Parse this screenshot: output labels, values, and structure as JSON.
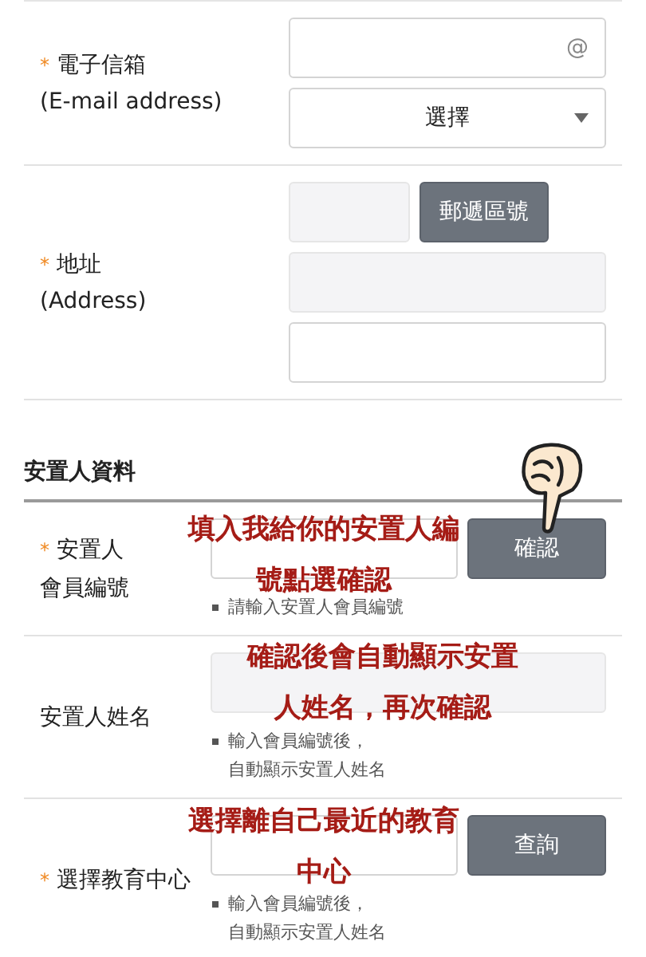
{
  "contact_rows": [
    {
      "kind": "email",
      "required_mark": "*",
      "label": "電子信箱",
      "sublabel": "(E-mail address)",
      "at_sign": "@",
      "select_value": "選擇"
    },
    {
      "kind": "address",
      "required_mark": "*",
      "label": "地址",
      "sublabel": "(Address)",
      "zip_button": "郵遞區號"
    }
  ],
  "section_title": "安置人資料",
  "sponsor_rows": [
    {
      "kind": "input_button",
      "required_mark": "*",
      "label": "安置人",
      "sublabel": "會員編號",
      "button": "確認",
      "help": [
        "請輸入安置人會員編號"
      ],
      "note": [
        "填入我給你的安置人編",
        "號點選確認"
      ]
    },
    {
      "kind": "readonly",
      "label": "安置人姓名",
      "help": [
        "輸入會員編號後，",
        "自動顯示安置人姓名"
      ],
      "note": [
        "確認後會自動顯示安置",
        "人姓名，再次確認"
      ]
    },
    {
      "kind": "input_button",
      "required_mark": "*",
      "label": "選擇教育中心",
      "button": "查詢",
      "help": [
        "輸入會員編號後，",
        "自動顯示安置人姓名"
      ],
      "note": [
        "選擇離自己最近的教育",
        "中心"
      ]
    }
  ]
}
